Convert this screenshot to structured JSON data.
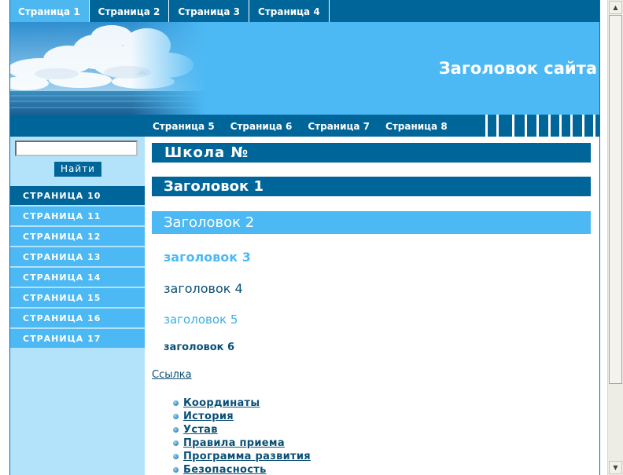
{
  "top_nav": [
    "Страница 1",
    "Страница 2",
    "Страница 3",
    "Страница 4"
  ],
  "header": {
    "title": "Заголовок сайта"
  },
  "sub_nav": [
    "Страница 5",
    "Страница 6",
    "Страница 7",
    "Страница 8"
  ],
  "search": {
    "value": "",
    "button_label": "Найти"
  },
  "side_menu": [
    "СТРАНИЦА 10",
    "СТРАНИЦА 11",
    "СТРАНИЦА 12",
    "СТРАНИЦА 13",
    "СТРАНИЦА 14",
    "СТРАНИЦА 15",
    "СТРАНИЦА 16",
    "СТРАНИЦА 17"
  ],
  "content": {
    "school_heading": "Школа №",
    "h1": "Заголовок 1",
    "h2": "Заголовок 2",
    "h3": "заголовок 3",
    "h4": "заголовок 4",
    "h5": "заголовок 5",
    "h6": "заголовок 6",
    "link": "Ссылка",
    "links": [
      "Координаты",
      "История",
      "Устав",
      "Правила приема",
      "Программа развития",
      "Безопасность"
    ]
  },
  "colors": {
    "dark_blue": "#006699",
    "light_blue": "#4cb9f4",
    "sidebar_bg": "#b3e2fb"
  }
}
